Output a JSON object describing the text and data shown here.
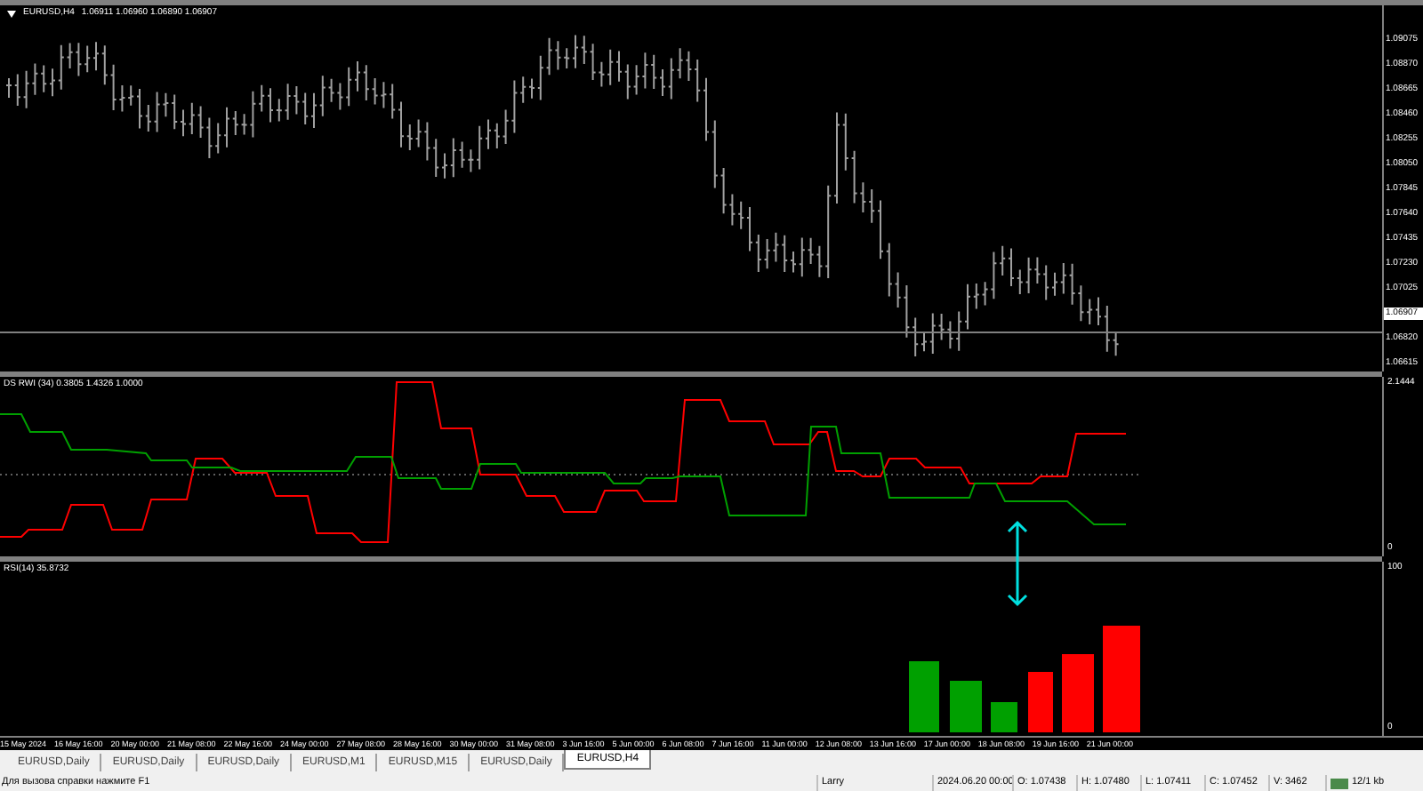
{
  "price_pane": {
    "symbol": "EURUSD,H4",
    "ohlc": "1.06911 1.06960 1.06890 1.06907",
    "axis_labels": [
      {
        "text": "1.09075",
        "highlighted": false
      },
      {
        "text": "1.08870",
        "highlighted": false
      },
      {
        "text": "1.08665",
        "highlighted": false
      },
      {
        "text": "1.08460",
        "highlighted": false
      },
      {
        "text": "1.08255",
        "highlighted": false
      },
      {
        "text": "1.08050",
        "highlighted": false
      },
      {
        "text": "1.07845",
        "highlighted": false
      },
      {
        "text": "1.07640",
        "highlighted": false
      },
      {
        "text": "1.07435",
        "highlighted": false
      },
      {
        "text": "1.07230",
        "highlighted": false
      },
      {
        "text": "1.07025",
        "highlighted": false
      },
      {
        "text": "1.06907",
        "highlighted": true
      },
      {
        "text": "1.06820",
        "highlighted": false
      },
      {
        "text": "1.06615",
        "highlighted": false
      }
    ]
  },
  "indicator_pane": {
    "title": "DS RWI (34) 0.3805 1.4326 1.0000",
    "axis_labels": [
      "2.1444",
      "0"
    ]
  },
  "rsi_pane": {
    "title": "RSI(14) 35.8732",
    "axis_labels": [
      "100",
      "0"
    ]
  },
  "time_axis": [
    "15 May 2024",
    "16 May 16:00",
    "20 May 00:00",
    "21 May 08:00",
    "22 May 16:00",
    "24 May 00:00",
    "27 May 08:00",
    "28 May 16:00",
    "30 May 00:00",
    "31 May 08:00",
    "3 Jun 16:00",
    "5 Jun 00:00",
    "6 Jun 08:00",
    "7 Jun 16:00",
    "11 Jun 00:00",
    "12 Jun 08:00",
    "13 Jun 16:00",
    "17 Jun 00:00",
    "18 Jun 08:00",
    "19 Jun 16:00",
    "21 Jun 00:00"
  ],
  "tabs": [
    {
      "label": "EURUSD,Daily",
      "selected": false
    },
    {
      "label": "EURUSD,Daily",
      "selected": false
    },
    {
      "label": "EURUSD,Daily",
      "selected": false
    },
    {
      "label": "EURUSD,M1",
      "selected": false
    },
    {
      "label": "EURUSD,M15",
      "selected": false
    },
    {
      "label": "EURUSD,Daily",
      "selected": false
    },
    {
      "label": "EURUSD,H4",
      "selected": true
    }
  ],
  "status_bar": {
    "help": "Для вызова справки нажмите F1",
    "profile": "Larry",
    "time": "2024.06.20 00:00",
    "open": "O: 1.07438",
    "high": "H: 1.07480",
    "low": "L: 1.07411",
    "close": "C: 1.07452",
    "volume": "V: 3462",
    "traffic": "12/1 kb"
  }
}
